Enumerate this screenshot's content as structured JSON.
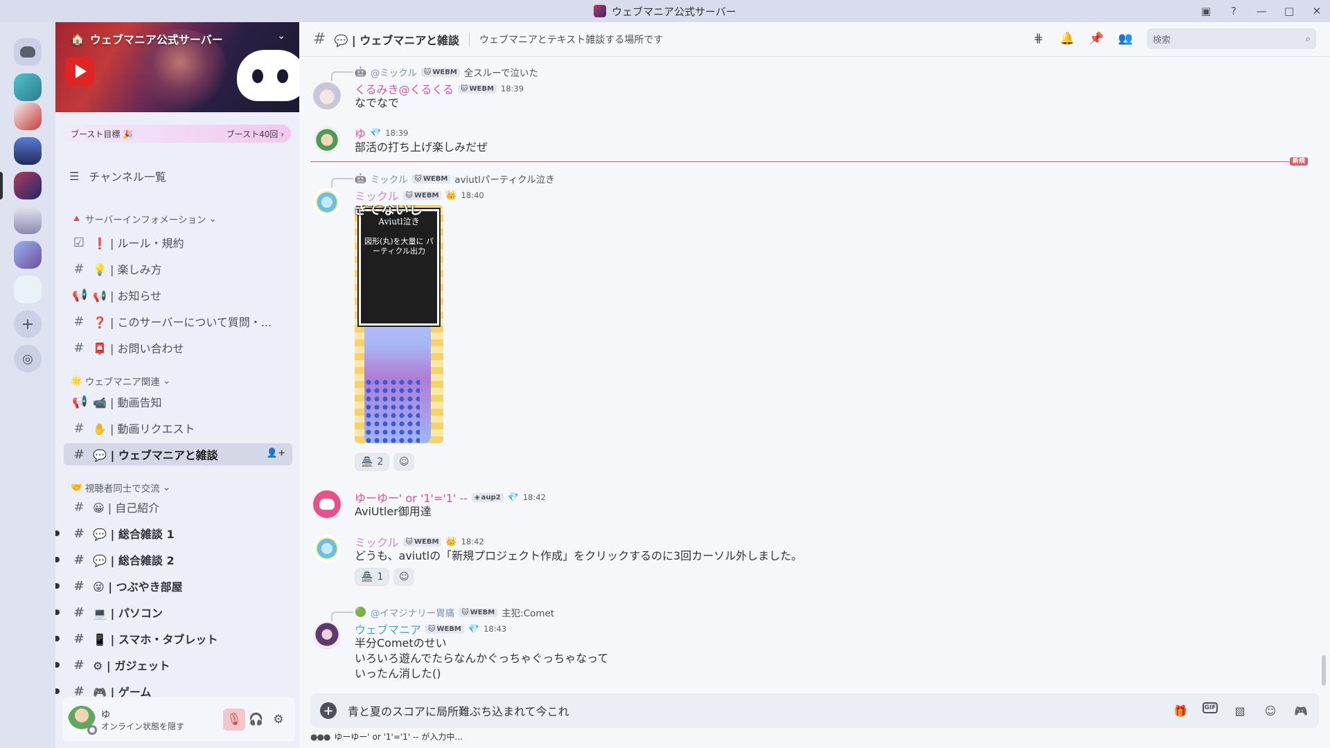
{
  "window": {
    "title": "ウェブマニア公式サーバー"
  },
  "server": {
    "name": "ウェブマニア公式サーバー",
    "boost_goal": "ブースト目標 🎉",
    "boost_count": "ブースト40回 ›",
    "channel_list_label": "チャンネル一覧"
  },
  "categories": [
    {
      "label": "サーバーインフォメーション",
      "icon": "🔺"
    },
    {
      "label": "ウェブマニア関連",
      "icon": "🌟"
    },
    {
      "label": "視聴者同士で交流",
      "icon": "🤝"
    }
  ],
  "channels": [
    {
      "label": "❗ | ルール・規約",
      "icon": "checkbox-icon"
    },
    {
      "label": "💡 | 楽しみ方",
      "icon": "hash-icon"
    },
    {
      "label": "📢 | お知らせ",
      "icon": "announcement-icon"
    },
    {
      "label": "❓ | このサーバーについて質問・...",
      "icon": "hash-icon"
    },
    {
      "label": "📮 | お問い合わせ",
      "icon": "hash-icon"
    },
    {
      "label": "📹 | 動画告知",
      "icon": "announcement-icon"
    },
    {
      "label": "✋ | 動画リクエスト",
      "icon": "hash-icon"
    },
    {
      "label": "💬 | ウェブマニアと雑談",
      "icon": "hash-icon"
    },
    {
      "label": "😀 | 自己紹介",
      "icon": "hash-icon"
    },
    {
      "label": "💬 | 総合雑談 1",
      "icon": "hash-icon"
    },
    {
      "label": "💬 | 総合雑談 2",
      "icon": "hash-icon"
    },
    {
      "label": "😜 | つぶやき部屋",
      "icon": "hash-icon"
    },
    {
      "label": "💻 | パソコン",
      "icon": "hash-icon"
    },
    {
      "label": "📱 | スマホ・タブレット",
      "icon": "hash-icon"
    },
    {
      "label": "⚙ | ガジェット",
      "icon": "hash-icon"
    },
    {
      "label": "🎮 | ゲーム",
      "icon": "hash-icon"
    }
  ],
  "user": {
    "name": "ゆ",
    "status": "オンライン状態を隠す"
  },
  "header": {
    "channel": "💬 | ウェブマニアと雑談",
    "topic": "ウェブマニアとテキスト雑談する場所です",
    "search_placeholder": "検索"
  },
  "messages": [
    {
      "reply_to": "@ミックル",
      "reply_tag": "WEBM",
      "reply_text": "全スルーで泣いた",
      "author": "くるみき@くるくる",
      "author_color": "#d357b5",
      "tag": "WEBM",
      "time": "18:39",
      "text": "なでなで"
    },
    {
      "author": "ゆ",
      "author_color": "#e34b9c",
      "time": "18:39",
      "text": "部活の打ち上げ楽しみだぜ"
    },
    {
      "reply_to": "ミックル",
      "reply_tag": "WEBM",
      "reply_text": "aviutlパーティクル泣き",
      "author": "ミックル",
      "author_color": "#c88bd7",
      "tag": "WEBM",
      "time": "18:40",
      "attachment_overlay": "きてないし",
      "attachment_title": "Aviutl泣き",
      "attachment_caption": "図形(丸)を大量に パーティクル出力",
      "reaction_count": "2"
    },
    {
      "author": "ゆーゆー' or '1'='1' --",
      "author_color": "#e34b9c",
      "tag": "aup2",
      "time": "18:42",
      "text": "AviUtler御用達"
    },
    {
      "author": "ミックル",
      "author_color": "#c88bd7",
      "tag": "WEBM",
      "time": "18:42",
      "text": "どうも、aviutlの「新規プロジェクト作成」をクリックするのに3回カーソル外しました。",
      "reaction_count": "1"
    },
    {
      "reply_to": "@イマジナリー胃痛",
      "reply_tag": "WEBM",
      "reply_text": "主犯:Comet",
      "author": "ウェブマニア",
      "author_color": "#3fa9d6",
      "tag": "WEBM",
      "time": "18:43",
      "lines": [
        "半分Cometのせい",
        "いろいろ遊んでたらなんかぐっちゃぐっちゃなって",
        "いったん消した()"
      ]
    }
  ],
  "new_divider_label": "新規",
  "composer": {
    "text": "青と夏のスコアに局所難ぶち込まれて今これ"
  },
  "typing": {
    "text": "ゆーゆー' or '1'='1' -- が入力中..."
  },
  "colors": {
    "accent": "#5865f2",
    "new_divider": "#e45b5b"
  }
}
